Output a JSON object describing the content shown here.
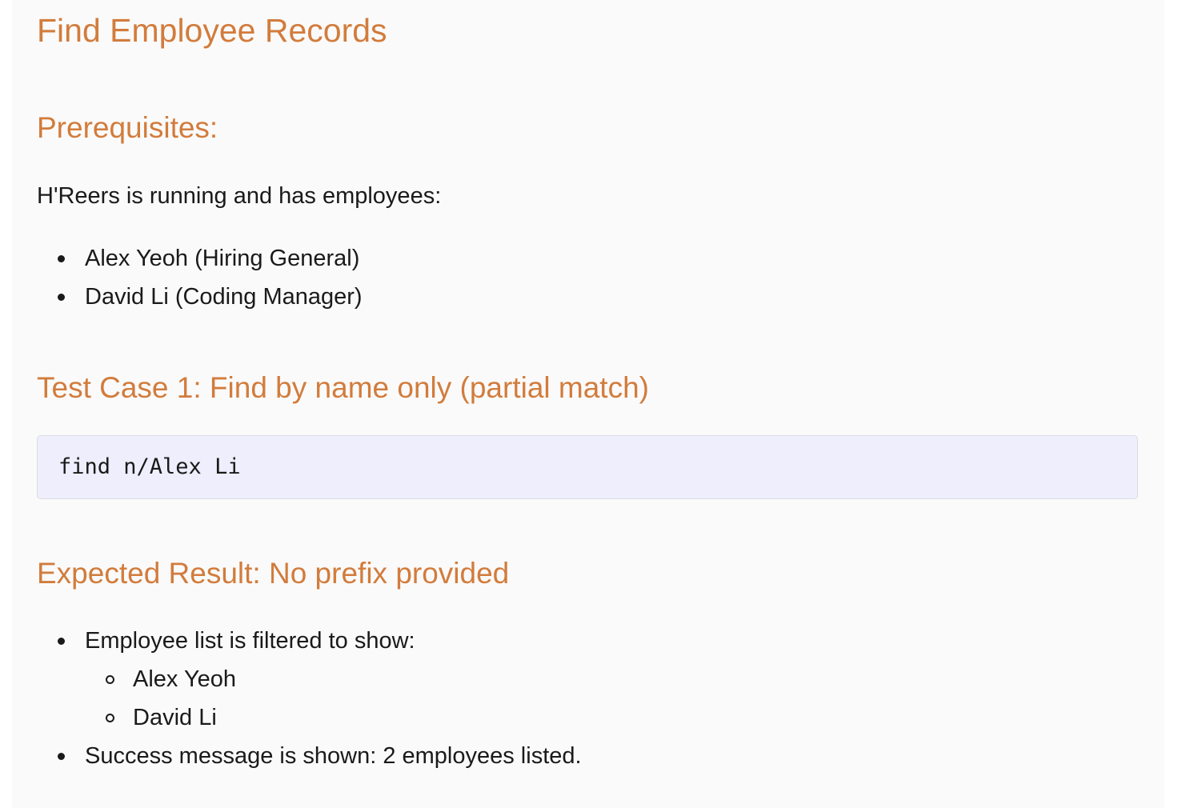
{
  "doc": {
    "title": "Find Employee Records",
    "prerequisites": {
      "heading": "Prerequisites:",
      "intro": "H'Reers is running and has employees:",
      "employees": [
        "Alex Yeoh (Hiring General)",
        "David Li (Coding Manager)"
      ]
    },
    "test_case": {
      "heading": "Test Case 1: Find by name only (partial match)",
      "command": "find n/Alex Li"
    },
    "expected": {
      "heading": "Expected Result: No prefix provided",
      "items": [
        {
          "text": "Employee list is filtered to show:",
          "subitems": [
            "Alex Yeoh",
            "David Li"
          ]
        },
        {
          "text": "Success message is shown: 2 employees listed."
        }
      ]
    }
  },
  "colors": {
    "heading": "#d27c3c",
    "code_background": "#eeeefc",
    "page_background": "#fafafa"
  }
}
